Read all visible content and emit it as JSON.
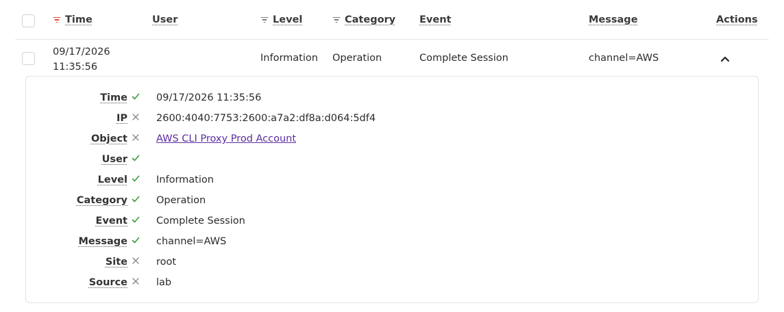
{
  "header": {
    "columns": [
      {
        "key": "time",
        "label": "Time",
        "filter": "active"
      },
      {
        "key": "user",
        "label": "User",
        "filter": "none"
      },
      {
        "key": "level",
        "label": "Level",
        "filter": "inactive"
      },
      {
        "key": "category",
        "label": "Category",
        "filter": "inactive"
      },
      {
        "key": "event",
        "label": "Event",
        "filter": "none"
      },
      {
        "key": "message",
        "label": "Message",
        "filter": "none"
      },
      {
        "key": "actions",
        "label": "Actions",
        "filter": "none"
      }
    ]
  },
  "row": {
    "time_date": "09/17/2026",
    "time_clock": "11:35:56",
    "user": "",
    "level": "Information",
    "category": "Operation",
    "event": "Complete Session",
    "message": "channel=AWS",
    "expand_icon": "chevron-up-icon"
  },
  "details": [
    {
      "label": "Time",
      "status": "check",
      "value": "09/17/2026 11:35:56"
    },
    {
      "label": "IP",
      "status": "cross",
      "value": "2600:4040:7753:2600:a7a2:df8a:d064:5df4"
    },
    {
      "label": "Object",
      "status": "cross",
      "value": "AWS CLI Proxy Prod Account",
      "link": true
    },
    {
      "label": "User",
      "status": "check",
      "value": ""
    },
    {
      "label": "Level",
      "status": "check",
      "value": "Information"
    },
    {
      "label": "Category",
      "status": "check",
      "value": "Operation"
    },
    {
      "label": "Event",
      "status": "check",
      "value": "Complete Session"
    },
    {
      "label": "Message",
      "status": "check",
      "value": "channel=AWS"
    },
    {
      "label": "Site",
      "status": "cross",
      "value": "root"
    },
    {
      "label": "Source",
      "status": "cross",
      "value": "lab"
    }
  ],
  "colors": {
    "check": "#3a9a3a",
    "cross": "#8a8a8a",
    "active_filter": "#e0443b",
    "link": "#5b2ca0"
  }
}
